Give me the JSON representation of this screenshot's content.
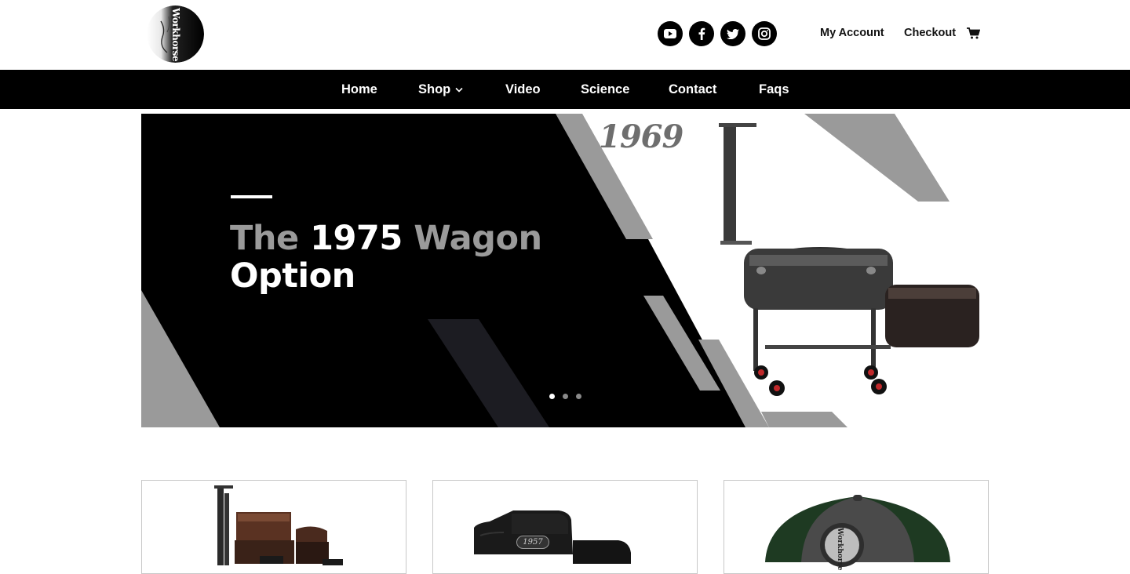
{
  "header": {
    "logo_text": "Workhorse",
    "social": [
      "youtube-icon",
      "facebook-icon",
      "twitter-icon",
      "instagram-icon"
    ],
    "account_label": "My Account",
    "checkout_label": "Checkout"
  },
  "nav": {
    "items": [
      {
        "label": "Home"
      },
      {
        "label": "Shop",
        "has_dropdown": true
      },
      {
        "label": "Video"
      },
      {
        "label": "Science"
      },
      {
        "label": "Contact"
      },
      {
        "label": "Faqs"
      }
    ]
  },
  "hero": {
    "title_1": "The",
    "title_2": "1975",
    "title_3": "Wagon",
    "title_4": "Option",
    "year": "1969",
    "slides_count": 3,
    "active_slide": 1
  },
  "products": [
    {
      "image": "offset-smoker-product"
    },
    {
      "image": "smoker-cover-product",
      "brand_text": "1957"
    },
    {
      "image": "trucker-hat-product",
      "brand_text": "Workhorse"
    }
  ],
  "colors": {
    "nav_bg": "#000000",
    "nav_text": "#ffffff",
    "hero_grey": "#9a9a9a",
    "accent_red": "#c0282a"
  }
}
